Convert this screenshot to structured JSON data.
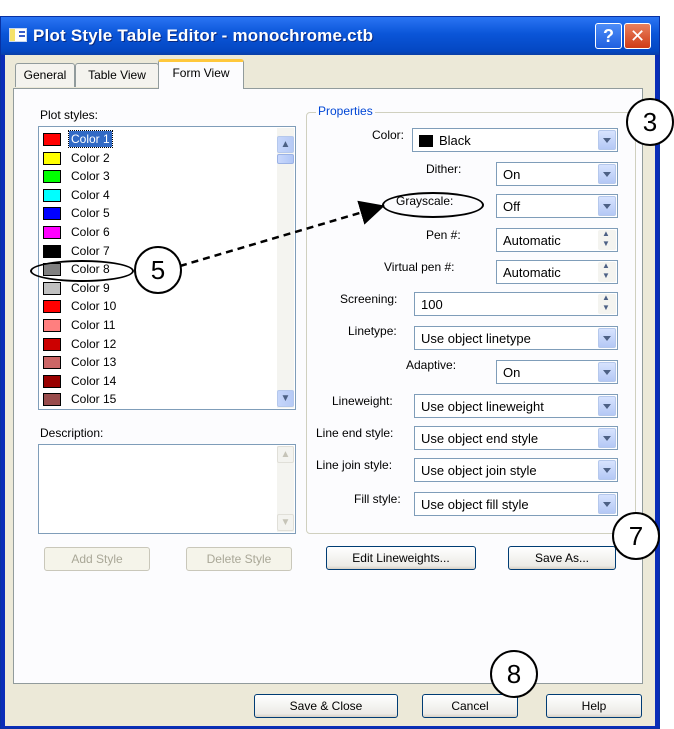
{
  "window": {
    "title": "Plot Style Table Editor - monochrome.ctb",
    "help_glyph": "?",
    "close_glyph": "✕"
  },
  "tabs": [
    {
      "label": "General"
    },
    {
      "label": "Table View"
    },
    {
      "label": "Form View",
      "active": true
    }
  ],
  "plot_styles": {
    "label": "Plot styles:",
    "items": [
      {
        "label": "Color 1",
        "color": "#ff0000",
        "selected": true
      },
      {
        "label": "Color 2",
        "color": "#ffff00"
      },
      {
        "label": "Color 3",
        "color": "#00ff00"
      },
      {
        "label": "Color 4",
        "color": "#00ffff"
      },
      {
        "label": "Color 5",
        "color": "#0000ff"
      },
      {
        "label": "Color 6",
        "color": "#ff00ff"
      },
      {
        "label": "Color 7",
        "color": "#000000"
      },
      {
        "label": "Color 8",
        "color": "#808080"
      },
      {
        "label": "Color 9",
        "color": "#c0c0c0"
      },
      {
        "label": "Color 10",
        "color": "#ff0000"
      },
      {
        "label": "Color 11",
        "color": "#ff7f7f"
      },
      {
        "label": "Color 12",
        "color": "#cc0000"
      },
      {
        "label": "Color 13",
        "color": "#cc6666"
      },
      {
        "label": "Color 14",
        "color": "#990000"
      },
      {
        "label": "Color 15",
        "color": "#994c4c"
      }
    ]
  },
  "description": {
    "label": "Description:"
  },
  "buttons": {
    "add_style": "Add Style",
    "delete_style": "Delete Style",
    "edit_lineweights": "Edit Lineweights...",
    "save_as": "Save As...",
    "save_close": "Save & Close",
    "cancel": "Cancel",
    "help": "Help"
  },
  "properties": {
    "title": "Properties",
    "color_label": "Color:",
    "color_value": "Black",
    "dither_label": "Dither:",
    "dither_value": "On",
    "grayscale_label": "Grayscale:",
    "grayscale_value": "Off",
    "pen_label": "Pen #:",
    "pen_value": "Automatic",
    "virtual_pen_label": "Virtual pen #:",
    "virtual_pen_value": "Automatic",
    "screening_label": "Screening:",
    "screening_value": "100",
    "linetype_label": "Linetype:",
    "linetype_value": "Use object linetype",
    "adaptive_label": "Adaptive:",
    "adaptive_value": "On",
    "lineweight_label": "Lineweight:",
    "lineweight_value": "Use object lineweight",
    "line_end_label": "Line end style:",
    "line_end_value": "Use object end style",
    "line_join_label": "Line join style:",
    "line_join_value": "Use object join style",
    "fill_label": "Fill style:",
    "fill_value": "Use object fill style"
  },
  "annotations": {
    "callout_3": "3",
    "callout_5": "5",
    "callout_7": "7",
    "callout_8": "8"
  }
}
